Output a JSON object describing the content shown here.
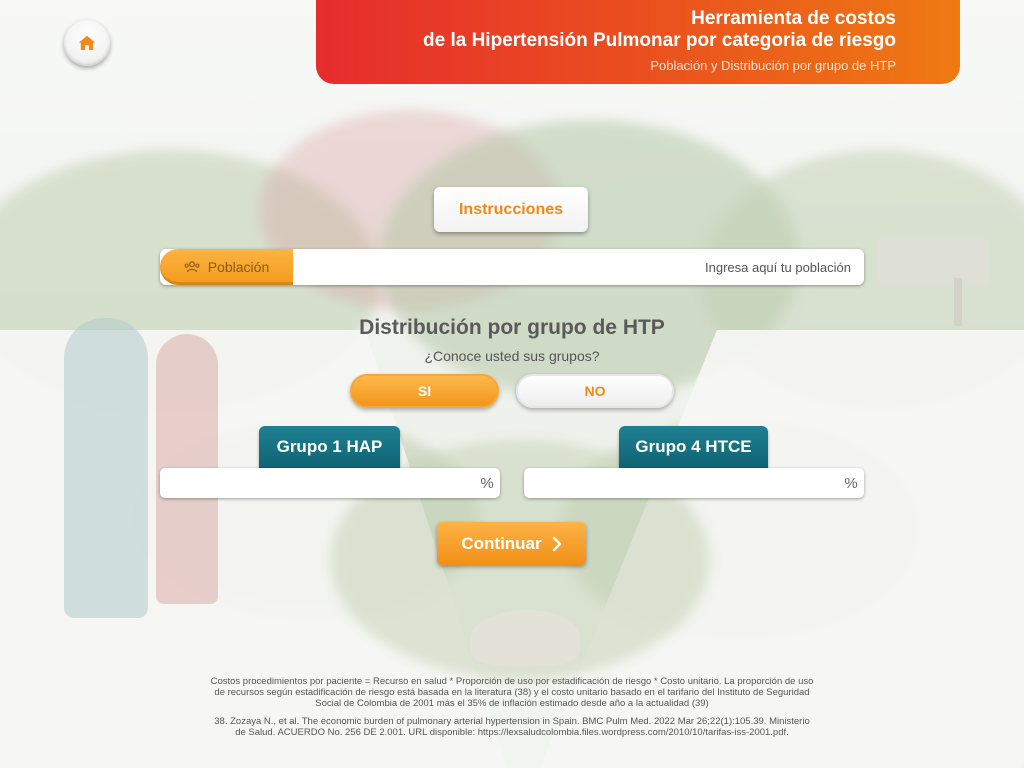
{
  "header": {
    "title_line1": "Herramienta de costos",
    "title_line2": "de la Hipertensión Pulmonar por categoria de riesgo",
    "subtitle": "Población y Distribución por grupo de HTP",
    "gradient_colors": [
      "#e52d2d",
      "#ee7a12"
    ]
  },
  "home": {
    "icon": "home-icon",
    "icon_color": "#f08a16"
  },
  "instructions": {
    "label": "Instrucciones"
  },
  "population": {
    "label": "Población",
    "icon": "people-icon",
    "value": "",
    "placeholder": "Ingresa aquí tu población"
  },
  "distribution": {
    "title": "Distribución por grupo de HTP",
    "question": "¿Conoce usted sus grupos?",
    "yes_label": "SI",
    "no_label": "NO",
    "selected": "SI"
  },
  "groups": [
    {
      "label": "Grupo 1 HAP",
      "value": "",
      "unit": "%"
    },
    {
      "label": "Grupo 4 HTCE",
      "value": "",
      "unit": "%"
    }
  ],
  "continue": {
    "label": "Continuar",
    "icon": "chevron-right-icon"
  },
  "notes": {
    "paragraph1": "Costos procedimientos por paciente = Recurso en salud * Proporción de uso por estadificación de riesgo * Costo unitario. La proporción de uso de recursos según estadificación de riesgo está basada en la literatura (38) y el costo unitario basado en el tarifario del Instituto de Seguridad Social de Colombia de 2001 más el 35% de inflación estimado desde año a la actualidad (39)",
    "paragraph2": "38. Zozaya N., et al. The economic burden of pulmonary arterial hypertension in Spain. BMC Pulm Med. 2022 Mar 26;22(1):105.39. Ministerio de Salud. ACUERDO No. 256 DE 2.001. URL disponible: https://lexsaludcolombia.files.wordpress.com/2010/10/tarifas-iss-2001.pdf."
  },
  "colors": {
    "accent_orange": "#f08a16",
    "teal": "#137083",
    "text_gray": "#555555"
  }
}
